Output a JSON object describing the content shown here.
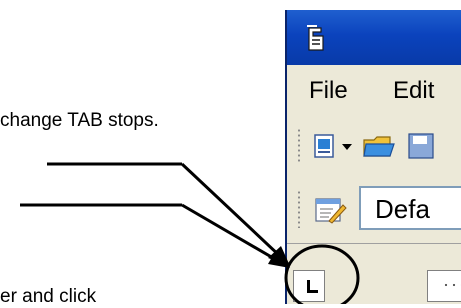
{
  "captions": {
    "line1": "change TAB stops.",
    "line2": "er and click"
  },
  "window": {
    "menu": {
      "file": "File",
      "edit": "Edit"
    },
    "style_box": {
      "value": "Defa"
    }
  },
  "colors": {
    "titlebar": "#0b43bd",
    "panel": "#ece9d8",
    "field_border": "#7f9db9",
    "annotation": "#000000"
  },
  "icons": [
    "app-icon",
    "new-document-icon",
    "dropdown-arrow-icon",
    "open-folder-icon",
    "save-icon",
    "styles-icon",
    "tab-stop-left-icon"
  ]
}
